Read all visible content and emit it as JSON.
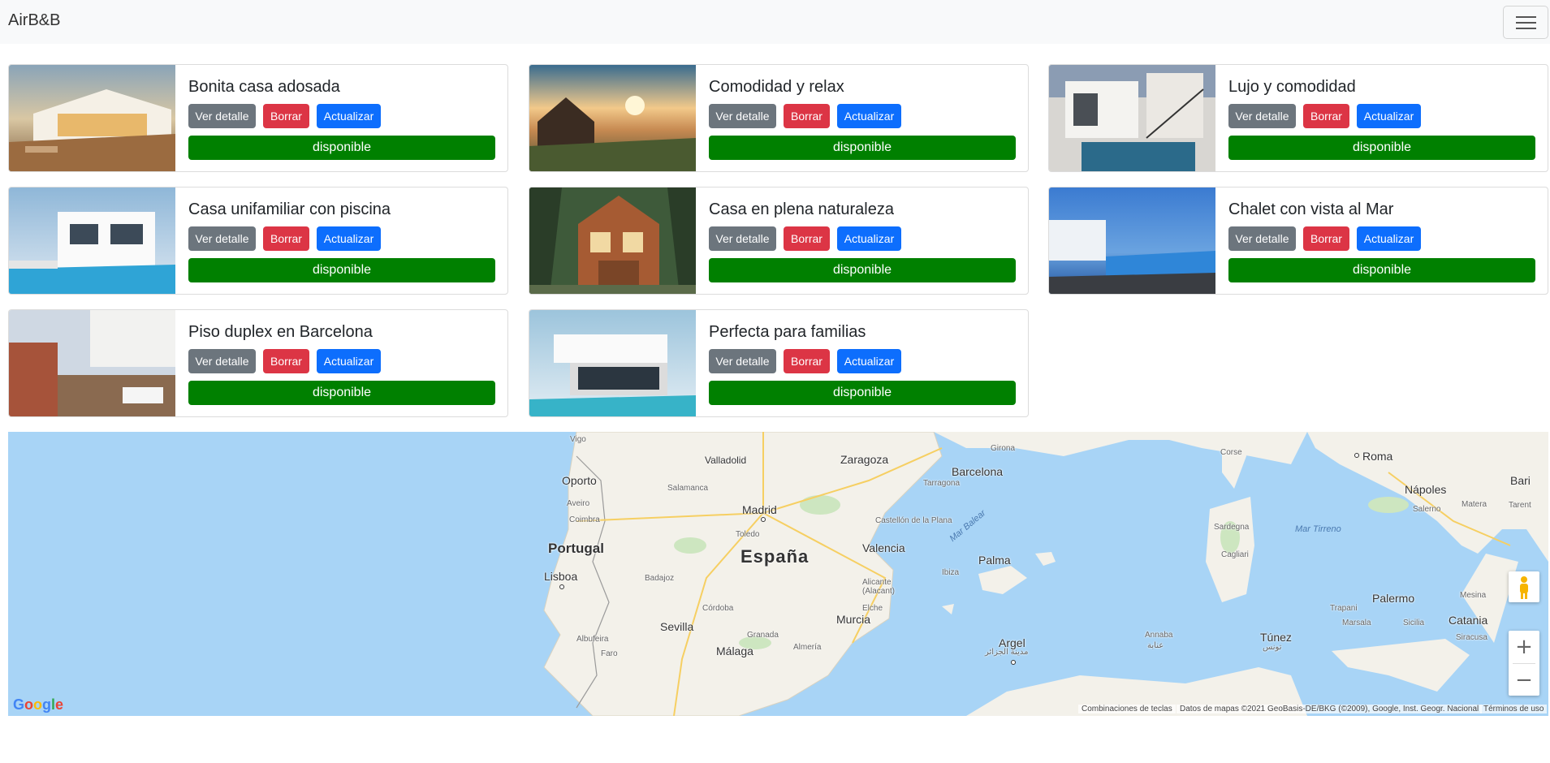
{
  "navbar": {
    "brand": "AirB&B",
    "menu_icon": "hamburger-menu-icon"
  },
  "buttons": {
    "detail": "Ver detalle",
    "delete": "Borrar",
    "update": "Actualizar"
  },
  "listings": [
    {
      "title": "Bonita casa adosada",
      "status": "disponible"
    },
    {
      "title": "Comodidad y relax",
      "status": "disponible"
    },
    {
      "title": "Lujo y comodidad",
      "status": "disponible"
    },
    {
      "title": "Casa unifamiliar con piscina",
      "status": "disponible"
    },
    {
      "title": "Casa en plena naturaleza",
      "status": "disponible"
    },
    {
      "title": "Chalet con vista al Mar",
      "status": "disponible"
    },
    {
      "title": "Piso duplex en Barcelona",
      "status": "disponible"
    },
    {
      "title": "Perfecta para familias",
      "status": "disponible"
    }
  ],
  "colors": {
    "detail": "#6c757d",
    "delete": "#dc3545",
    "update": "#0d6efd",
    "status": "#008000",
    "navbar": "#f8f9fa",
    "sea": "#a8d4f6",
    "land": "#f3f1ea"
  },
  "map": {
    "labels": {
      "portugal": "Portugal",
      "espana": "España",
      "madrid": "Madrid",
      "barcelona": "Barcelona",
      "valencia": "Valencia",
      "sevilla": "Sevilla",
      "malaga": "Málaga",
      "lisboa": "Lisboa",
      "oporto": "Oporto",
      "zaragoza": "Zaragoza",
      "murcia": "Murcia",
      "palma": "Palma",
      "roma": "Roma",
      "napoles": "Nápoles",
      "palermo": "Palermo",
      "catania": "Catania",
      "argel": "Argel",
      "tunez": "Túnez",
      "valladolid": "Valladolid",
      "salamanca": "Salamanca",
      "coimbra": "Coimbra",
      "aveiro": "Aveiro",
      "vigo": "Vigo",
      "toledo": "Toledo",
      "badajoz": "Badajoz",
      "cordoba": "Córdoba",
      "granada": "Granada",
      "almeria": "Almería",
      "alicante": "Alicante\n(Alacant)",
      "elche": "Elche",
      "castellon": "Castellón\nde la Plana",
      "tarragona": "Tarragona",
      "girona": "Girona",
      "ibiza": "Ibiza",
      "cerdena": "Sardegna",
      "cagliari": "Cagliari",
      "corse": "Corse",
      "bari": "Bari",
      "salerno": "Salerno",
      "matera": "Matera",
      "tarent": "Tarent",
      "mesina": "Mesina",
      "trapani": "Trapani",
      "marsala": "Marsala",
      "sicilia": "Sicilia",
      "siracusa": "Siracusa",
      "annaba": "Annaba",
      "albufeira": "Albufeira",
      "faro": "Faro",
      "mar_balear": "Mar Balear",
      "mar_tirreno": "Mar Tirreno",
      "tunez_ar": "تونس",
      "argel_ar": "مدينة الجزائر",
      "annaba_ar": "عنابة"
    },
    "google": "Google",
    "shortcuts": "Combinaciones de teclas",
    "attribution": "Datos de mapas ©2021 GeoBasis-DE/BKG (©2009), Google, Inst. Geogr. Nacional",
    "terms": "Términos de uso",
    "zoom_in": "+",
    "zoom_out": "−",
    "pegman_icon": "street-view-pegman-icon"
  }
}
